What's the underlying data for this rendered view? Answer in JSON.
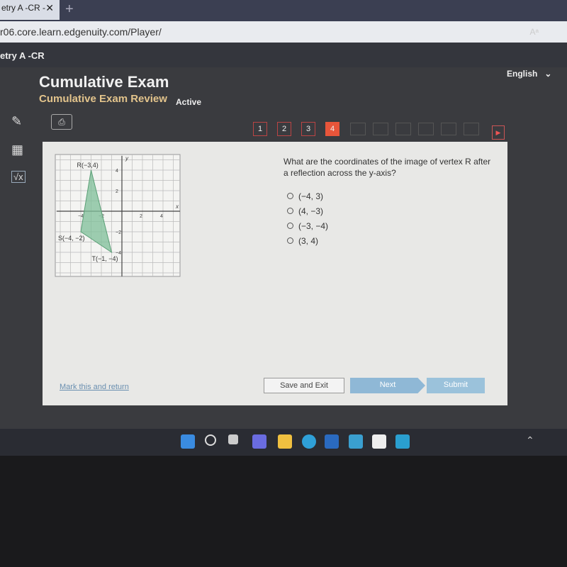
{
  "browser": {
    "tab_title": "etry A -CR -",
    "url": "r06.core.learn.edgenuity.com/Player/",
    "reader_icon": "Aᵃ"
  },
  "app": {
    "course": "etry A -CR",
    "language": "English"
  },
  "header": {
    "title": "Cumulative Exam",
    "subtitle": "Cumulative Exam Review",
    "status": "Active"
  },
  "nav": {
    "questions": [
      "1",
      "2",
      "3",
      "4"
    ],
    "current": "4"
  },
  "question": {
    "text": "What are the coordinates of the image of vertex R after a reflection across the y-axis?",
    "options": [
      "(−4, 3)",
      "(4, −3)",
      "(−3, −4)",
      "(3, 4)"
    ]
  },
  "graph": {
    "x_label": "x",
    "y_label": "y",
    "ticks_x": [
      "−4",
      "−2",
      "2",
      "4"
    ],
    "ticks_y": [
      "4",
      "2",
      "−2",
      "−4"
    ],
    "points": [
      {
        "label": "R(−3,4)",
        "x": -3,
        "y": 4
      },
      {
        "label": "S(−4, −2)",
        "x": -4,
        "y": -2
      },
      {
        "label": "T(−1, −4)",
        "x": -1,
        "y": -4
      }
    ],
    "fill_color": "#7fbf98"
  },
  "footer": {
    "mark": "Mark this and return",
    "save": "Save and Exit",
    "next": "Next",
    "submit": "Submit"
  },
  "colors": {
    "accent": "#e8553a",
    "subtitle": "#e3c48c"
  }
}
